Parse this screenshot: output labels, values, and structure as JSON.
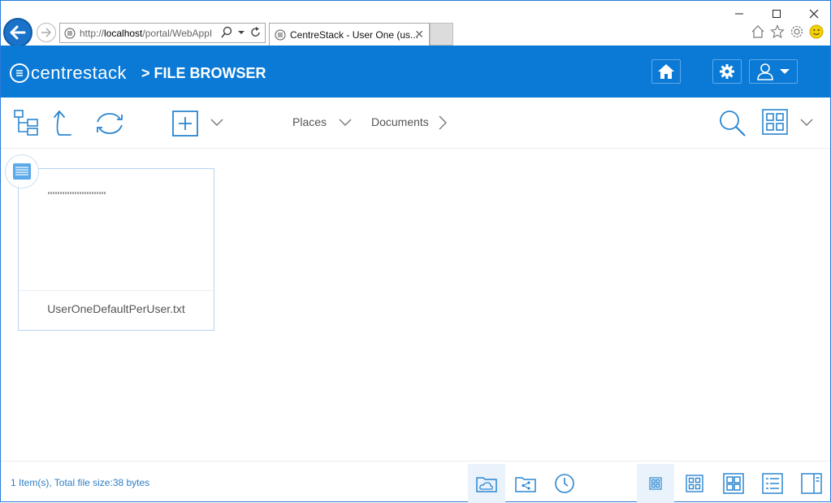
{
  "browser": {
    "url_prefix": "http://",
    "url_host": "localhost",
    "url_path": "/portal/WebAppI",
    "tab_title": "CentreStack - User One (us..."
  },
  "header": {
    "brand": "centrestack",
    "breadcrumb": ">  FILE BROWSER"
  },
  "toolbar": {
    "places_label": "Places",
    "documents_label": "Documents"
  },
  "files": [
    {
      "name": "UserOneDefaultPerUser.txt",
      "type_icon": "text-file-icon"
    }
  ],
  "status": {
    "summary": "1 Item(s), Total file size:38 bytes"
  },
  "colors": {
    "brand_blue": "#0a7ad6",
    "icon_blue": "#2b86d0"
  }
}
